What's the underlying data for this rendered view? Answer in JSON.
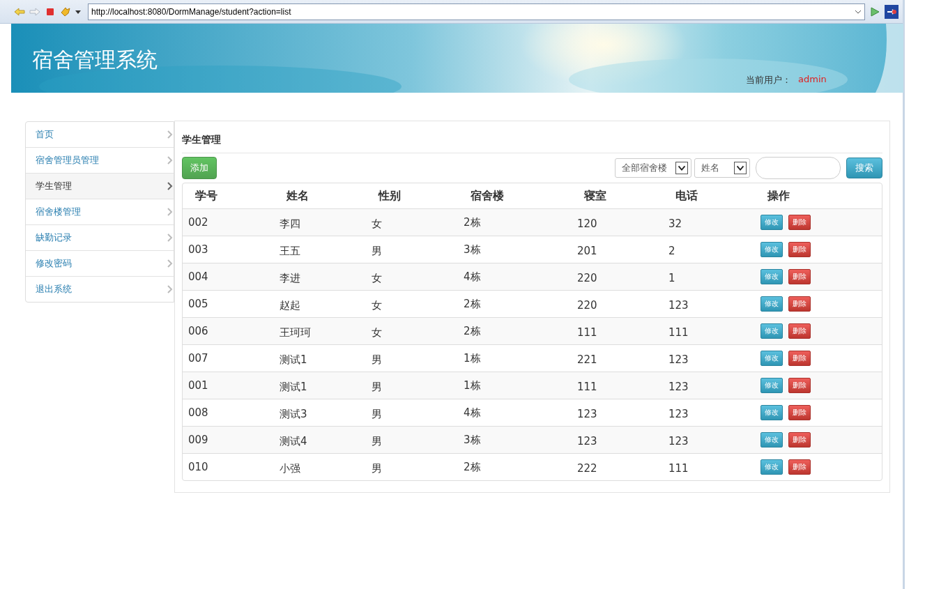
{
  "browser": {
    "url": "http://localhost:8080/DormManage/student?action=list"
  },
  "header": {
    "title": "宿舍管理系统",
    "user_label": "当前用户：",
    "user": "admin"
  },
  "sidebar": {
    "items": [
      {
        "label": "首页",
        "selected": false
      },
      {
        "label": "宿舍管理员管理",
        "selected": false
      },
      {
        "label": "学生管理",
        "selected": true
      },
      {
        "label": "宿舍楼管理",
        "selected": false
      },
      {
        "label": "缺勤记录",
        "selected": false
      },
      {
        "label": "修改密码",
        "selected": false
      },
      {
        "label": "退出系统",
        "selected": false
      }
    ]
  },
  "panel": {
    "title": "学生管理",
    "add_button": "添加",
    "building_select": "全部宿舍楼",
    "field_select": "姓名",
    "search_button": "搜索"
  },
  "table": {
    "columns": [
      "学号",
      "姓名",
      "性别",
      "宿舍楼",
      "寝室",
      "电话",
      "操作"
    ],
    "rows": [
      {
        "cells": [
          "002",
          "李四",
          "女",
          "2栋",
          "120",
          "32"
        ],
        "edit": "修改",
        "delete": "删除"
      },
      {
        "cells": [
          "003",
          "王五",
          "男",
          "3栋",
          "201",
          "2"
        ],
        "edit": "修改",
        "delete": "删除"
      },
      {
        "cells": [
          "004",
          "李进",
          "女",
          "4栋",
          "220",
          "1"
        ],
        "edit": "修改",
        "delete": "删除"
      },
      {
        "cells": [
          "005",
          "赵起",
          "女",
          "2栋",
          "220",
          "123"
        ],
        "edit": "修改",
        "delete": "删除"
      },
      {
        "cells": [
          "006",
          "王珂珂",
          "女",
          "2栋",
          "111",
          "111"
        ],
        "edit": "修改",
        "delete": "删除"
      },
      {
        "cells": [
          "007",
          "测试1",
          "男",
          "1栋",
          "221",
          "123"
        ],
        "edit": "修改",
        "delete": "删除"
      },
      {
        "cells": [
          "001",
          "测试1",
          "男",
          "1栋",
          "111",
          "123"
        ],
        "edit": "修改",
        "delete": "删除"
      },
      {
        "cells": [
          "008",
          "测试3",
          "男",
          "4栋",
          "123",
          "123"
        ],
        "edit": "修改",
        "delete": "删除"
      },
      {
        "cells": [
          "009",
          "测试4",
          "男",
          "3栋",
          "123",
          "123"
        ],
        "edit": "修改",
        "delete": "删除"
      },
      {
        "cells": [
          "010",
          "小强",
          "男",
          "2栋",
          "222",
          "111"
        ],
        "edit": "修改",
        "delete": "删除"
      }
    ]
  }
}
